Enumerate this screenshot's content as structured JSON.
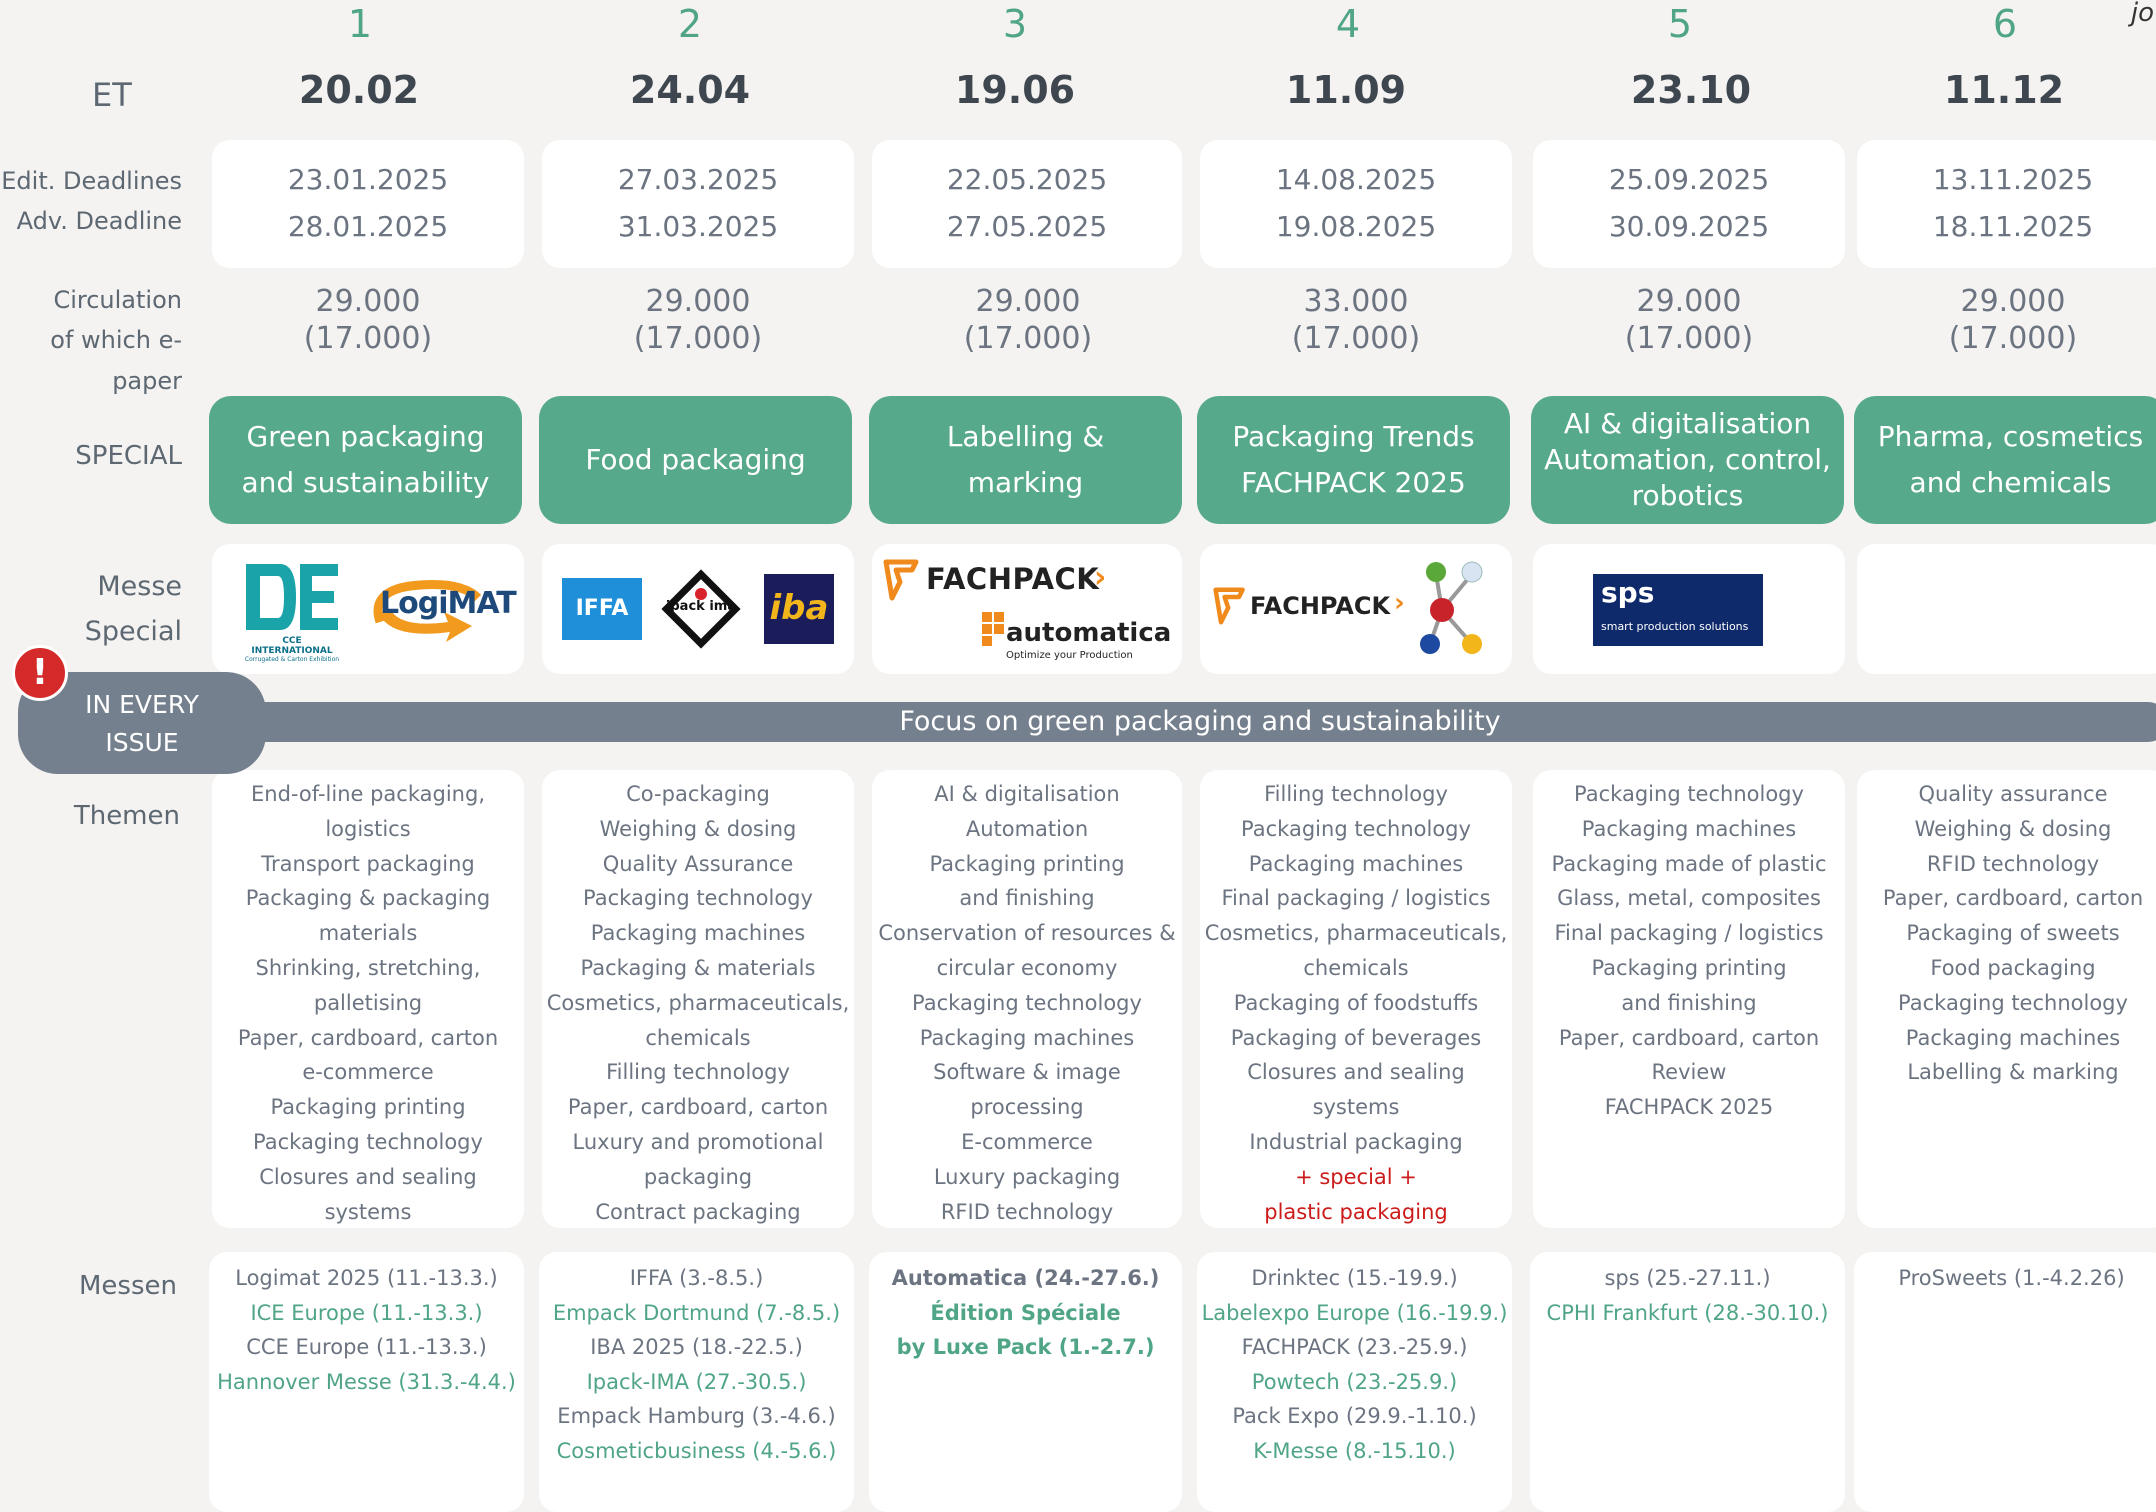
{
  "row_labels": {
    "et": "ET",
    "edit_deadlines": "Edit. Deadlines",
    "adv_deadline": "Adv. Deadline",
    "circulation": "Circulation",
    "of_which_epaper": "of which e-paper",
    "special": "SPECIAL",
    "messe": "Messe",
    "messe_special": "Special",
    "themen": "Themen",
    "messen": "Messen"
  },
  "corner_text": "jo",
  "banner": {
    "badge_line1": "IN EVERY",
    "badge_line2": "ISSUE",
    "focus": "Focus on green packaging and sustainability",
    "alert_glyph": "!"
  },
  "issues": [
    {
      "number": "1",
      "et": "20.02",
      "edit_deadline": "23.01.2025",
      "adv_deadline": "28.01.2025",
      "circulation": "29.000",
      "epaper": "(17.000)",
      "special": [
        "Green packaging",
        "and sustainability"
      ],
      "logos": [
        "CCE INTERNATIONAL",
        "LogiMAT"
      ],
      "logo_sub": "Corrugated & Carton Exhibition",
      "topics": [
        "End-of-line packaging,",
        "logistics",
        "Transport packaging",
        "Packaging & packaging",
        "materials",
        "Shrinking, stretching,",
        "palletising",
        "Paper, cardboard, carton",
        "e-commerce",
        "Packaging printing",
        "Packaging technology",
        "Closures and sealing",
        "systems"
      ],
      "fairs": [
        {
          "text": "Logimat 2025 (11.-13.3.)",
          "green": false
        },
        {
          "text": "ICE Europe (11.-13.3.)",
          "green": true
        },
        {
          "text": "CCE Europe (11.-13.3.)",
          "green": false
        },
        {
          "text": "Hannover Messe (31.3.-4.4.)",
          "green": true
        }
      ]
    },
    {
      "number": "2",
      "et": "24.04",
      "edit_deadline": "27.03.2025",
      "adv_deadline": "31.03.2025",
      "circulation": "29.000",
      "epaper": "(17.000)",
      "special": [
        "Food packaging"
      ],
      "logos": [
        "IFFA",
        "ipack ima",
        "iba"
      ],
      "topics": [
        "Co-packaging",
        "Weighing & dosing",
        "Quality Assurance",
        "Packaging technology",
        "Packaging machines",
        "Packaging & materials",
        "Cosmetics, pharmaceuticals,",
        "chemicals",
        "Filling technology",
        "Paper, cardboard, carton",
        "Luxury and promotional",
        "packaging",
        "Contract packaging"
      ],
      "fairs": [
        {
          "text": "IFFA (3.-8.5.)",
          "green": false
        },
        {
          "text": "Empack Dortmund (7.-8.5.)",
          "green": true
        },
        {
          "text": "IBA 2025 (18.-22.5.)",
          "green": false
        },
        {
          "text": "Ipack-IMA (27.-30.5.)",
          "green": true
        },
        {
          "text": "Empack Hamburg (3.-4.6.)",
          "green": false
        },
        {
          "text": "Cosmeticbusiness (4.-5.6.)",
          "green": true
        }
      ]
    },
    {
      "number": "3",
      "et": "19.06",
      "edit_deadline": "22.05.2025",
      "adv_deadline": "27.05.2025",
      "circulation": "29.000",
      "epaper": "(17.000)",
      "special": [
        "Labelling &",
        "marking"
      ],
      "logos": [
        "FACHPACK",
        "automatica"
      ],
      "logo_sub": "Optimize your Production",
      "topics": [
        "AI & digitalisation",
        "Automation",
        "Packaging printing",
        "and finishing",
        "Conservation of resources &",
        "circular economy",
        "Packaging technology",
        "Packaging machines",
        "Software & image",
        "processing",
        "E-commerce",
        "Luxury packaging",
        "RFID technology"
      ],
      "fairs": [
        {
          "text": "Automatica (24.-27.6.)",
          "green": false,
          "bold": true
        },
        {
          "text": "Édition Spéciale",
          "green": true,
          "bold": true
        },
        {
          "text": "by Luxe Pack (1.-2.7.)",
          "green": true,
          "bold": true
        }
      ]
    },
    {
      "number": "4",
      "et": "11.09",
      "edit_deadline": "14.08.2025",
      "adv_deadline": "19.08.2025",
      "circulation": "33.000",
      "epaper": "(17.000)",
      "special": [
        "Packaging Trends",
        "FACHPACK 2025"
      ],
      "logos": [
        "FACHPACK"
      ],
      "topics": [
        "Filling technology",
        "Packaging technology",
        "Packaging machines",
        "Final packaging / logistics",
        "Cosmetics, pharmaceuticals,",
        "chemicals",
        "Packaging of foodstuffs",
        "Packaging of beverages",
        "Closures and sealing",
        "systems",
        "Industrial packaging"
      ],
      "topics_red": [
        "+ special +",
        "plastic packaging"
      ],
      "fairs": [
        {
          "text": "Drinktec (15.-19.9.)",
          "green": false
        },
        {
          "text": "Labelexpo Europe (16.-19.9.)",
          "green": true
        },
        {
          "text": "FACHPACK (23.-25.9.)",
          "green": false
        },
        {
          "text": "Powtech  (23.-25.9.)",
          "green": true
        },
        {
          "text": "Pack Expo (29.9.-1.10.)",
          "green": false
        },
        {
          "text": "K-Messe (8.-15.10.)",
          "green": true
        }
      ]
    },
    {
      "number": "5",
      "et": "23.10",
      "edit_deadline": "25.09.2025",
      "adv_deadline": "30.09.2025",
      "circulation": "29.000",
      "epaper": "(17.000)",
      "special": [
        "AI & digitalisation",
        "Automation, control,",
        "robotics"
      ],
      "logos": [
        "sps"
      ],
      "logo_sub": "smart production solutions",
      "topics": [
        "Packaging technology",
        "Packaging machines",
        "Packaging made of plastic",
        "Glass, metal, composites",
        "Final packaging / logistics",
        "Packaging printing",
        "and finishing",
        "Paper, cardboard, carton",
        "Review",
        "FACHPACK 2025"
      ],
      "fairs": [
        {
          "text": "sps (25.-27.11.)",
          "green": false
        },
        {
          "text": "CPHI Frankfurt  (28.-30.10.)",
          "green": true
        }
      ]
    },
    {
      "number": "6",
      "et": "11.12",
      "edit_deadline": "13.11.2025",
      "adv_deadline": "18.11.2025",
      "circulation": "29.000",
      "epaper": "(17.000)",
      "special": [
        "Pharma, cosmetics",
        "and chemicals"
      ],
      "logos": [],
      "topics": [
        "Quality assurance",
        "Weighing & dosing",
        "RFID technology",
        "Paper, cardboard, carton",
        "Packaging of sweets",
        "Food packaging",
        "Packaging technology",
        "Packaging machines",
        "Labelling & marking"
      ],
      "fairs": [
        {
          "text": "ProSweets (1.-4.2.26)",
          "green": false
        }
      ]
    }
  ],
  "colors": {
    "accent_green": "#57a98c",
    "text_green": "#4fa585",
    "banner_gray": "#75808e",
    "alert_red": "#d42a2a",
    "special_red": "#cc1b1b"
  }
}
